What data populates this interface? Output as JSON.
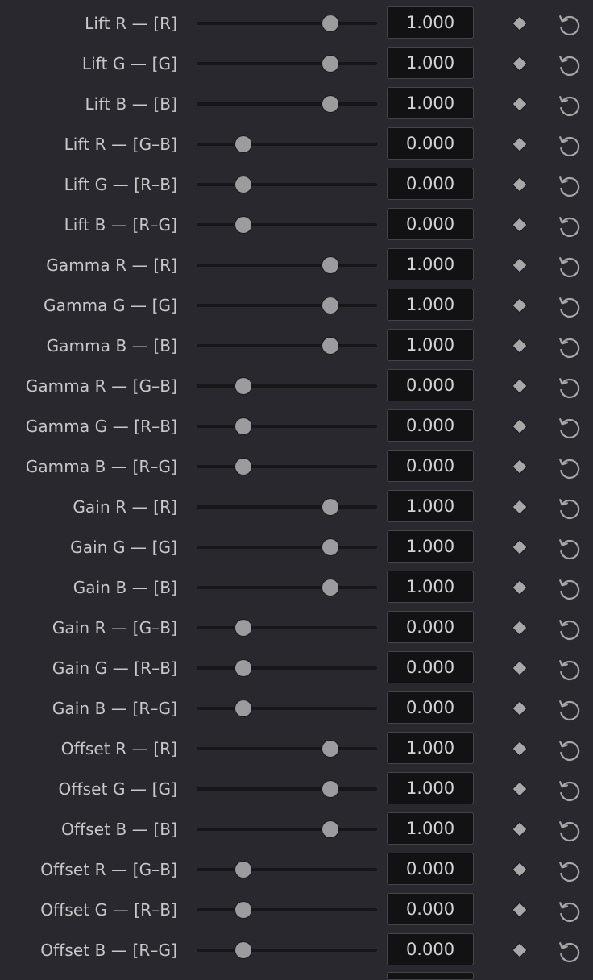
{
  "panel": {
    "rows": [
      {
        "label": "Lift R — [R]",
        "value": "1.000",
        "level": 1.0
      },
      {
        "label": "Lift G — [G]",
        "value": "1.000",
        "level": 1.0
      },
      {
        "label": "Lift B — [B]",
        "value": "1.000",
        "level": 1.0
      },
      {
        "label": "Lift R — [G–B]",
        "value": "0.000",
        "level": 0.0
      },
      {
        "label": "Lift G — [R–B]",
        "value": "0.000",
        "level": 0.0
      },
      {
        "label": "Lift B — [R–G]",
        "value": "0.000",
        "level": 0.0
      },
      {
        "label": "Gamma R — [R]",
        "value": "1.000",
        "level": 1.0
      },
      {
        "label": "Gamma G — [G]",
        "value": "1.000",
        "level": 1.0
      },
      {
        "label": "Gamma B — [B]",
        "value": "1.000",
        "level": 1.0
      },
      {
        "label": "Gamma R — [G–B]",
        "value": "0.000",
        "level": 0.0
      },
      {
        "label": "Gamma G — [R–B]",
        "value": "0.000",
        "level": 0.0
      },
      {
        "label": "Gamma B — [R–G]",
        "value": "0.000",
        "level": 0.0
      },
      {
        "label": "Gain R — [R]",
        "value": "1.000",
        "level": 1.0
      },
      {
        "label": "Gain G — [G]",
        "value": "1.000",
        "level": 1.0
      },
      {
        "label": "Gain B — [B]",
        "value": "1.000",
        "level": 1.0
      },
      {
        "label": "Gain R — [G–B]",
        "value": "0.000",
        "level": 0.0
      },
      {
        "label": "Gain G — [R–B]",
        "value": "0.000",
        "level": 0.0
      },
      {
        "label": "Gain B — [R–G]",
        "value": "0.000",
        "level": 0.0
      },
      {
        "label": "Offset R — [R]",
        "value": "1.000",
        "level": 1.0
      },
      {
        "label": "Offset G — [G]",
        "value": "1.000",
        "level": 1.0
      },
      {
        "label": "Offset B — [B]",
        "value": "1.000",
        "level": 1.0
      },
      {
        "label": "Offset R — [G–B]",
        "value": "0.000",
        "level": 0.0
      },
      {
        "label": "Offset G — [R–B]",
        "value": "0.000",
        "level": 0.0
      },
      {
        "label": "Offset B — [R–G]",
        "value": "0.000",
        "level": 0.0
      }
    ],
    "slider_range": [
      -1,
      2
    ],
    "icons": {
      "keyframe": "diamond-keyframe-icon",
      "reset": "reset-icon"
    },
    "colors": {
      "background": "#28282e",
      "value_field": "#121215",
      "knob": "#9c9c9e",
      "icon": "#a8a8ab"
    }
  }
}
